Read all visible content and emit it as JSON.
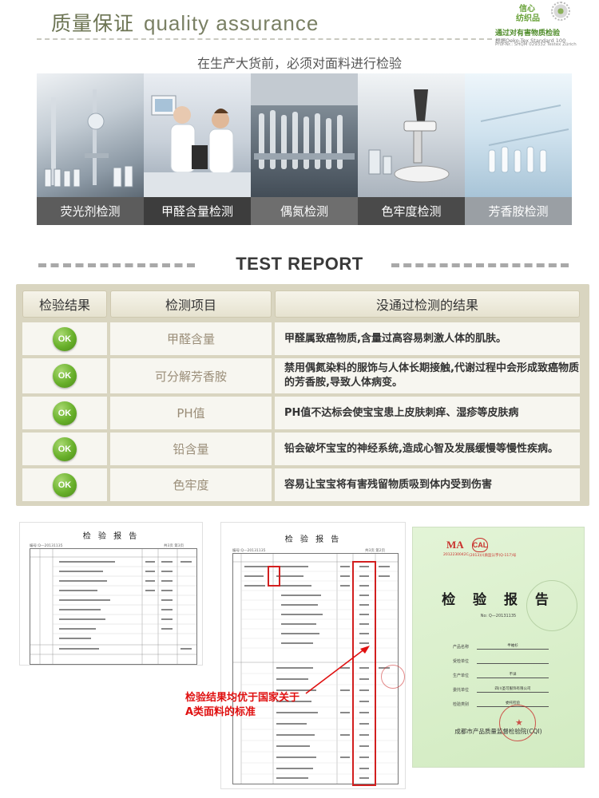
{
  "header": {
    "title_cn": "质量保证",
    "title_en": "quality assurance",
    "cert": {
      "badge_line1": "信心",
      "badge_line2": "纺织品",
      "line1": "通过对有害物质检验",
      "line2": "根据Oeko-Tex Standard 100",
      "line3": "Prüf-Nr.: SHQM 029332 Testex Zürich"
    }
  },
  "intro": "在生产大货前，必须对面料进行检验",
  "tests": [
    {
      "label": "荧光剂检测",
      "icon": "lab-glassware-photo"
    },
    {
      "label": "甲醛含量检测",
      "icon": "scientist-microscope-photo"
    },
    {
      "label": "偶氮检测",
      "icon": "test-tubes-photo"
    },
    {
      "label": "色牢度检测",
      "icon": "microscope-photo"
    },
    {
      "label": "芳香胺检测",
      "icon": "pipette-lab-photo"
    }
  ],
  "report_heading": "TEST REPORT",
  "table": {
    "headers": [
      "检验结果",
      "检测项目",
      "没通过检测的结果"
    ],
    "ok_label": "OK",
    "rows": [
      {
        "item": "甲醛含量",
        "result": "甲醛属致癌物质,含量过高容易刺激人体的肌肤。"
      },
      {
        "item": "可分解芳香胺",
        "result": "禁用偶氮染料的服饰与人体长期接触,代谢过程中会形成致癌物质的芳香胺,导致人体病变。"
      },
      {
        "item": "PH值",
        "result": "PH值不达标会使宝宝患上皮肤刺痒、湿疹等皮肤病"
      },
      {
        "item": "铅含量",
        "result": "铅会破坏宝宝的神经系统,造成心智及发展缓慢等慢性疾病。"
      },
      {
        "item": "色牢度",
        "result": "容易让宝宝将有害残留物质吸到体内受到伤害"
      }
    ]
  },
  "documents": {
    "doc1_title": "检 验 报 告",
    "doc1_ref": "编号:Q—20131135",
    "doc1_page": "共3页 第3页",
    "doc2_title": "检 验 报 告",
    "doc2_ref": "编号:Q—20131135",
    "doc2_page": "共3页 第2页",
    "annotation_line1": "检验结果均优于国家关于",
    "annotation_line2": "A类面料的标准",
    "cover": {
      "ma": "MA",
      "ma_num": "2012230042C",
      "cal": "CAL",
      "cal_num": "(2013)川质监认字(Q-117)号",
      "title": "检 验 报 告",
      "no": "No: Q—20131135",
      "fields": [
        {
          "label": "产品名称",
          "value": "半袖衫"
        },
        {
          "label": "受检单位",
          "value": ""
        },
        {
          "label": "生产单位",
          "value": "不详"
        },
        {
          "label": "委托单位",
          "value": "四川圣可服饰有限公司"
        },
        {
          "label": "检验类别",
          "value": "委托检验"
        }
      ],
      "institution": "成都市产品质量监督检验院(CQI)"
    }
  }
}
